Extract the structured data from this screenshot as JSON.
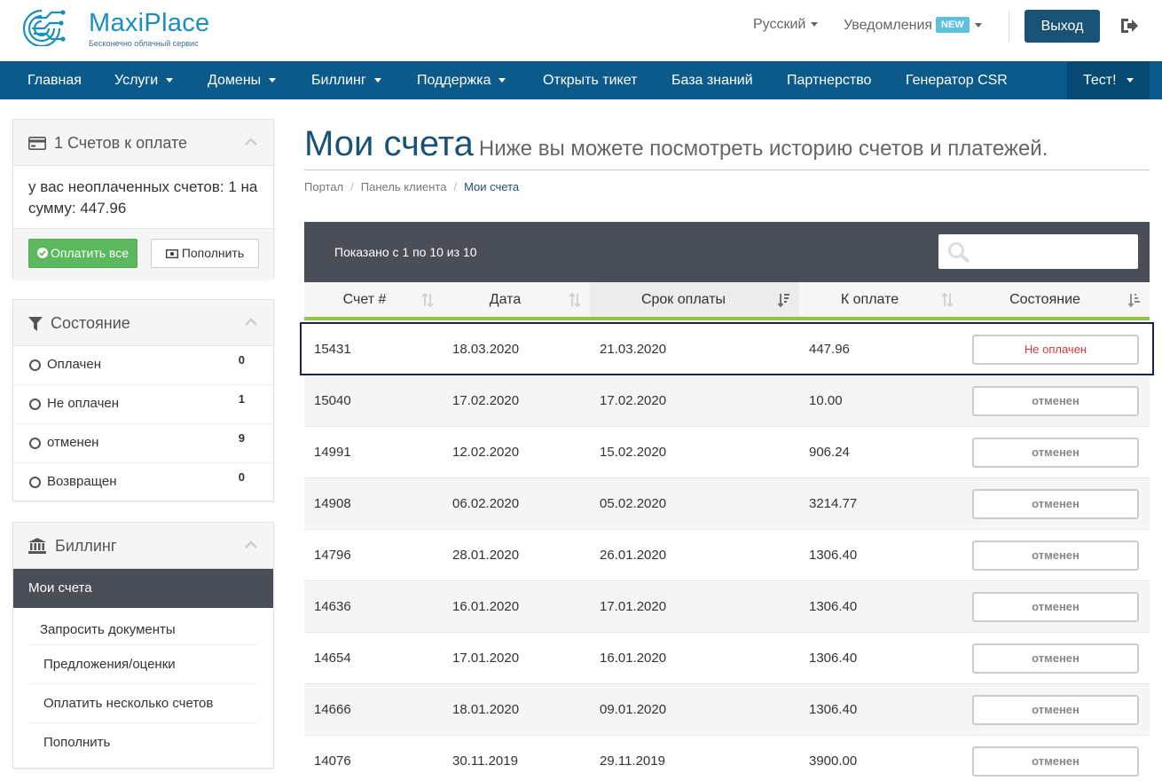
{
  "header": {
    "logo_name": "MaxiPlace",
    "logo_tagline": "Бесконечно облачный сервис",
    "language_label": "Русский",
    "notifications_label": "Уведомления",
    "new_badge": "NEW",
    "logout_label": "Выход",
    "icons": [
      "logo-circuit-icon",
      "logout-icon",
      "chevron-down-icon"
    ]
  },
  "nav": {
    "items": [
      {
        "label": "Главная",
        "has_dropdown": false
      },
      {
        "label": "Услуги",
        "has_dropdown": true
      },
      {
        "label": "Домены",
        "has_dropdown": true
      },
      {
        "label": "Биллинг",
        "has_dropdown": true
      },
      {
        "label": "Поддержка",
        "has_dropdown": true
      },
      {
        "label": "Открыть тикет",
        "has_dropdown": false
      },
      {
        "label": "База знаний",
        "has_dropdown": false
      },
      {
        "label": "Партнерство",
        "has_dropdown": false
      },
      {
        "label": "Генератор CSR",
        "has_dropdown": false
      }
    ],
    "account_label": "Тест!"
  },
  "sidebar": {
    "due_panel": {
      "title": "1 Счетов к оплате",
      "text": "у вас неоплаченных счетов: 1 на сумму: 447.96",
      "pay_all_label": "Оплатить все",
      "topup_label": "Пополнить"
    },
    "status_panel": {
      "title": "Состояние",
      "items": [
        {
          "label": "Оплачен",
          "count": "0"
        },
        {
          "label": "Не оплачен",
          "count": "1"
        },
        {
          "label": "отменен",
          "count": "9"
        },
        {
          "label": "Возвращен",
          "count": "0"
        }
      ]
    },
    "billing_panel": {
      "title": "Биллинг",
      "active_item": "Мои счета",
      "items": [
        {
          "label": "Запросить документы"
        },
        {
          "label": "Предложения/оценки"
        },
        {
          "label": "Оплатить несколько счетов"
        },
        {
          "label": "Пополнить"
        }
      ]
    }
  },
  "main": {
    "title": "Мои счета",
    "subtitle": "Ниже вы можете посмотреть историю счетов и платежей.",
    "breadcrumb": [
      "Портал",
      "Панель клиента",
      "Мои счета"
    ],
    "table_info": "Показано с 1 по 10 из 10",
    "search_placeholder": "",
    "columns": [
      "Счет #",
      "Дата",
      "Срок оплаты",
      "К оплате",
      "Состояние"
    ],
    "rows": [
      {
        "id": "15431",
        "date": "18.03.2020",
        "due": "21.03.2020",
        "amount": "447.96",
        "status": "Не оплачен"
      },
      {
        "id": "15040",
        "date": "17.02.2020",
        "due": "17.02.2020",
        "amount": "10.00",
        "status": "отменен"
      },
      {
        "id": "14991",
        "date": "12.02.2020",
        "due": "15.02.2020",
        "amount": "906.24",
        "status": "отменен"
      },
      {
        "id": "14908",
        "date": "06.02.2020",
        "due": "05.02.2020",
        "amount": "3214.77",
        "status": "отменен"
      },
      {
        "id": "14796",
        "date": "28.01.2020",
        "due": "26.01.2020",
        "amount": "1306.40",
        "status": "отменен"
      },
      {
        "id": "14636",
        "date": "16.01.2020",
        "due": "17.01.2020",
        "amount": "1306.40",
        "status": "отменен"
      },
      {
        "id": "14654",
        "date": "17.01.2020",
        "due": "16.01.2020",
        "amount": "1306.40",
        "status": "отменен"
      },
      {
        "id": "14666",
        "date": "18.01.2020",
        "due": "09.01.2020",
        "amount": "1306.40",
        "status": "отменен"
      },
      {
        "id": "14076",
        "date": "30.11.2019",
        "due": "29.11.2019",
        "amount": "3900.00",
        "status": "отменен"
      }
    ]
  },
  "colors": {
    "brand": "#1a5276",
    "nav": "#0b5a8a",
    "accent_green": "#8dc63f",
    "button_green": "#5cb85c",
    "unpaid_red": "#d9373a",
    "table_header_dark": "#4a4f57"
  }
}
